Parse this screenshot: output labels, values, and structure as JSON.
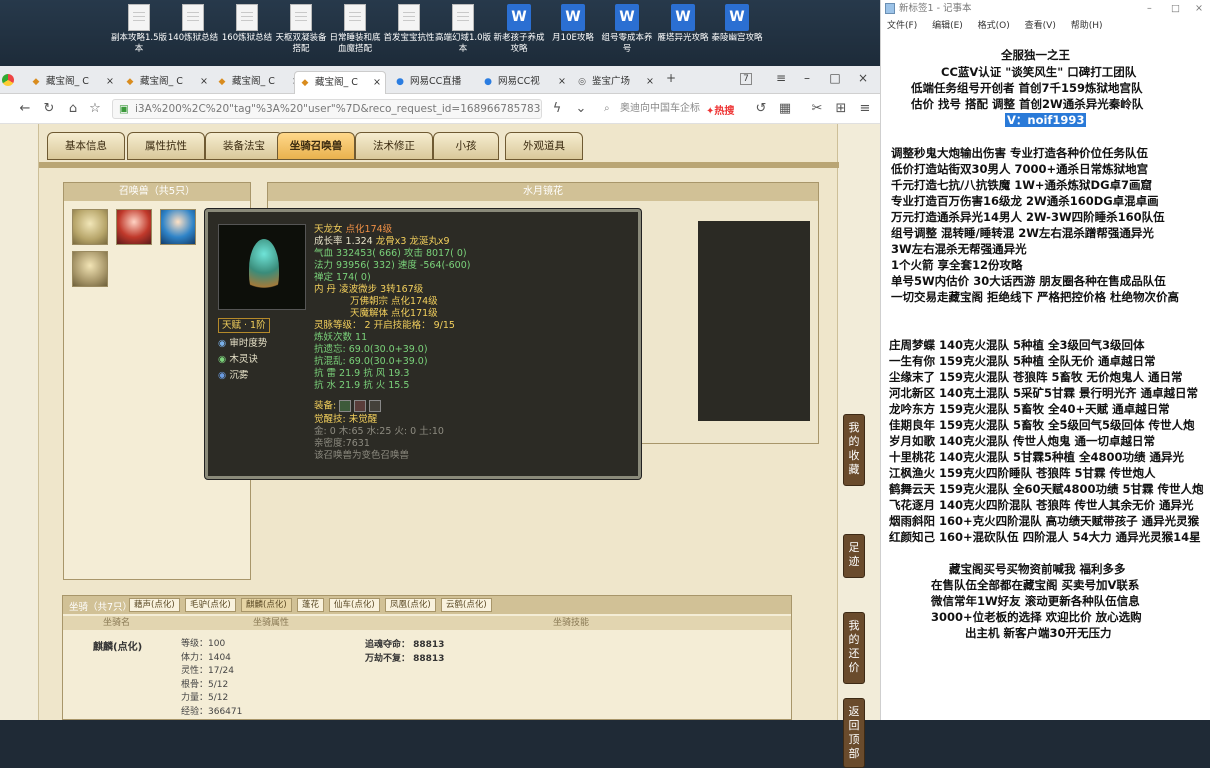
{
  "desktop": {
    "icons": [
      {
        "label": "副本攻略1.5版本",
        "type": "file"
      },
      {
        "label": "140炼狱总结",
        "type": "file"
      },
      {
        "label": "160炼狱总结",
        "type": "file"
      },
      {
        "label": "天枢双凝装备搭配",
        "type": "file"
      },
      {
        "label": "日常睡装和底血魔搭配",
        "type": "file"
      },
      {
        "label": "首发宝宝抗性",
        "type": "file"
      },
      {
        "label": "高端幻域1.0版本",
        "type": "file"
      },
      {
        "label": "新老孩子养成攻略",
        "type": "word"
      },
      {
        "label": "月10E攻略",
        "type": "word"
      },
      {
        "label": "组号零成本养号",
        "type": "word"
      },
      {
        "label": "雁塔异光攻略",
        "type": "word"
      },
      {
        "label": "秦陵幽宫攻略",
        "type": "word"
      }
    ]
  },
  "browser": {
    "tabs": [
      {
        "label": "藏宝阁_ C"
      },
      {
        "label": "藏宝阁_ C"
      },
      {
        "label": "藏宝阁_ C"
      },
      {
        "label": "藏宝阁_ C"
      },
      {
        "label": "网易CC直播"
      },
      {
        "label": "网易CC视"
      },
      {
        "label": "鉴宝广场"
      }
    ],
    "tab_count_badge": "7",
    "url": "i3A%200%2C%20\"tag\"%3A%20\"user\"%7D&reco_request_id=1689667857834zqddM",
    "search_placeholder": "奥迪向中国车企标",
    "hot_label": "热搜"
  },
  "game": {
    "tabs": [
      "基本信息",
      "属性抗性",
      "装备法宝",
      "坐骑召唤兽",
      "法术修正",
      "小孩",
      "外观道具"
    ],
    "active_tab": "坐骑召唤兽",
    "summon_list_title": "召唤兽（共5只）",
    "detail_title": "水月镜花",
    "tooltip": {
      "name": "天龙女",
      "name_suffix": "点化174级",
      "growth": "成长率 1.324",
      "items": "龙骨x3 龙涎丸x9",
      "hp_label": "气血",
      "hp": "332453( 666)",
      "atk_label": "攻击",
      "atk": "8017( 0)",
      "mp_label": "法力",
      "mp": "93956( 332)",
      "spd_label": "速度",
      "spd": "-564(-600)",
      "chan_label": "禅定",
      "chan": "174( 0)",
      "neidan_label": "内  丹",
      "neidan1": "凌波微步 3转167级",
      "neidan2": "万佛朝宗 点化174级",
      "neidan3": "天魔解体 点化171级",
      "tianfu": "天赋 · 1阶",
      "skills": [
        "审时度势",
        "木灵诀",
        "沉雾"
      ],
      "spirit_level": "灵脉等级：  2 开启技能格：  9/15",
      "lianyao": "炼妖次数 11",
      "kangfeng": "抗遗忘: 69.0(30.0+39.0)",
      "kanghunluan": "抗混乱: 69.0(30.0+39.0)",
      "kanglei": "抗    雷  21.9 抗    风  19.3",
      "kangshui": "抗    水  21.9 抗    火  15.5",
      "equip_label": "装备:",
      "juexing": "觉醒技:  未觉醒",
      "wuxing": "金: 0 木:65 水:25 火: 0 土:10",
      "qinmi": "亲密度:7631",
      "footer": "该召唤兽为变色召唤兽"
    },
    "side_buttons": [
      "我的收藏",
      "足迹",
      "我的还价",
      "返回顶部"
    ],
    "mounts": {
      "title": "坐骑（共7只）",
      "tabs": [
        "藉声(点化)",
        "毛驴(点化)",
        "麒麟(点化)",
        "蓬花",
        "仙车(点化)",
        "凤凰(点化)",
        "云鹤(点化)"
      ],
      "col_name": "坐骑名",
      "col_attr": "坐骑属性",
      "col_skill": "坐骑技能",
      "name": "麒麟(点化)",
      "attrs": [
        "等级：100",
        "体力：1404",
        "灵性：17/24",
        "根骨：5/12",
        "力量：5/12",
        "经验：366471"
      ],
      "skills": [
        "追魂夺命：  88813",
        "万劫不复：  88813"
      ]
    }
  },
  "notepad": {
    "title": "新标签1 - 记事本",
    "menu": [
      "文件(F)",
      "编辑(E)",
      "格式(O)",
      "查看(V)",
      "帮助(H)"
    ],
    "lines": [
      "全服独一之王",
      "CC蓝V认证 \"谈笑风生\" 口碑打工团队",
      "低端任务组号开创者                首创7千159炼狱地宫队",
      "估价 找号 搭配 调整               首创2W通杀异光秦岭队",
      "V：noif1993",
      "调整秒鬼大炮输出伤害          专业打造各种价位任务队伍",
      "低价打造站街双30男人           7000+通杀日常炼狱地宫",
      "千元打造七抗/八抗铁魔          1W+通杀炼狱DG卓7画窟",
      "专业打造百万伤害16级龙          2W通杀160DG卓混卓画",
      "万元打造通杀异光14男人        2W-3W四阶睡杀160队伍",
      "组号调整 混转睡/睡转混           2W左右混杀蹭帮强通异光",
      "                                          3W左右混杀无帮强通异光",
      "1个火箭 享全套12份攻略",
      "单号5W内估价 30大话西游        朋友圈各种在售成品队伍",
      "一切交易走藏宝阁 拒绝线下     严格把控价格 杜绝物次价高",
      "庄周梦蝶 140克火混队 5种植 全3级回气3级回体",
      "一生有你 159克火混队 5种植 全队无价 通卓越日常",
      "尘缘末了 159克火混队 苍狼阵 5畜牧 无价炮鬼人 通日常",
      "河北新区 140克土混队 5采矿5甘霖 景行明光齐 通卓越日常",
      "龙吟东方 159克火混队 5畜牧 全40+天赋 通卓越日常",
      "佳期良年 159克火混队 5畜牧 全5级回气5级回体 传世人炮",
      "岁月如歌 140克火混队 传世人炮鬼 通一切卓越日常",
      "十里桃花 140克火混队 5甘霖5种植 全4800功绩 通异光",
      "江枫渔火 159克火四阶睡队 苍狼阵 5甘霖 传世炮人",
      "鹤舞云天 159克火混队 全60天赋4800功绩 5甘霖 传世人炮",
      "飞花逐月 140克火四阶混队 苍狼阵 传世人其余无价 通异光",
      "烟雨斜阳 160+克火四阶混队 高功绩天赋带孩子 通异光灵猴",
      "红颜知己 160+混砍队伍 四阶混人 54大力 通异光灵猴14星",
      "藏宝阁买号买物资前喊我 福利多多",
      "在售队伍全部都在藏宝阁 买卖号加V联系",
      "微信常年1W好友 滚动更新各种队伍信息",
      "3000+位老板的选择 欢迎比价 放心选购",
      "出主机 新客户端30开无压力"
    ]
  }
}
